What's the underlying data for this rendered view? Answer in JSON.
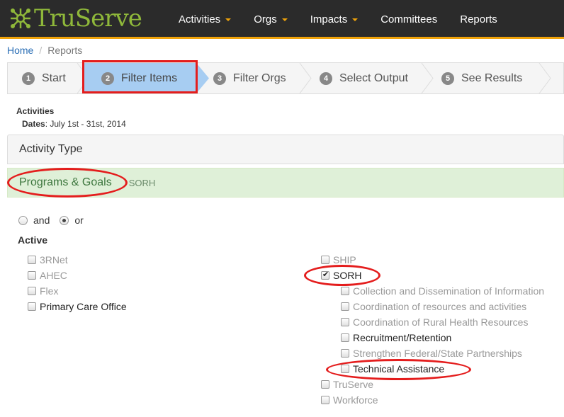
{
  "app": {
    "logo_text": "TruServe"
  },
  "nav": {
    "items": [
      {
        "label": "Activities",
        "has_caret": true
      },
      {
        "label": "Orgs",
        "has_caret": true
      },
      {
        "label": "Impacts",
        "has_caret": true
      },
      {
        "label": "Committees",
        "has_caret": false
      },
      {
        "label": "Reports",
        "has_caret": false
      }
    ]
  },
  "breadcrumb": {
    "home": "Home",
    "current": "Reports"
  },
  "wizard": {
    "steps": [
      {
        "num": "1",
        "label": "Start"
      },
      {
        "num": "2",
        "label": "Filter Items"
      },
      {
        "num": "3",
        "label": "Filter Orgs"
      },
      {
        "num": "4",
        "label": "Select Output"
      },
      {
        "num": "5",
        "label": "See Results"
      }
    ],
    "active_step": 2
  },
  "summary": {
    "title": "Activities",
    "dates_label": "Dates",
    "dates_value": ": July 1st - 31st, 2014"
  },
  "panels": {
    "activity_type": "Activity Type",
    "programs_goals": "Programs & Goals",
    "programs_sub": "SORH"
  },
  "match_mode": {
    "and_label": "and",
    "or_label": "or",
    "selected": "or"
  },
  "active_label": "Active",
  "programs_left": [
    {
      "label": "3RNet",
      "checked": false
    },
    {
      "label": "AHEC",
      "checked": false
    },
    {
      "label": "Flex",
      "checked": false
    },
    {
      "label": "Primary Care Office",
      "checked": false
    }
  ],
  "programs_right": [
    {
      "label": "SHIP",
      "checked": false
    },
    {
      "label": "SORH",
      "checked": true
    },
    {
      "label": "TruServe",
      "checked": false
    },
    {
      "label": "Workforce",
      "checked": false
    }
  ],
  "sorh_goals": [
    {
      "label": "Collection and Dissemination of Information",
      "checked": false
    },
    {
      "label": "Coordination of resources and activities",
      "checked": false
    },
    {
      "label": "Coordination of Rural Health Resources",
      "checked": false
    },
    {
      "label": "Recruitment/Retention",
      "checked": false
    },
    {
      "label": "Strengthen Federal/State Partnerships",
      "checked": false
    },
    {
      "label": "Technical Assistance",
      "checked": false
    }
  ],
  "colors": {
    "navbar": "#2b2b2b",
    "accent": "#f0a30a",
    "brand": "#8fb83a",
    "active_step": "#a7cdf2",
    "annotation": "#e41d1d",
    "success_bg": "#dff0d8"
  }
}
